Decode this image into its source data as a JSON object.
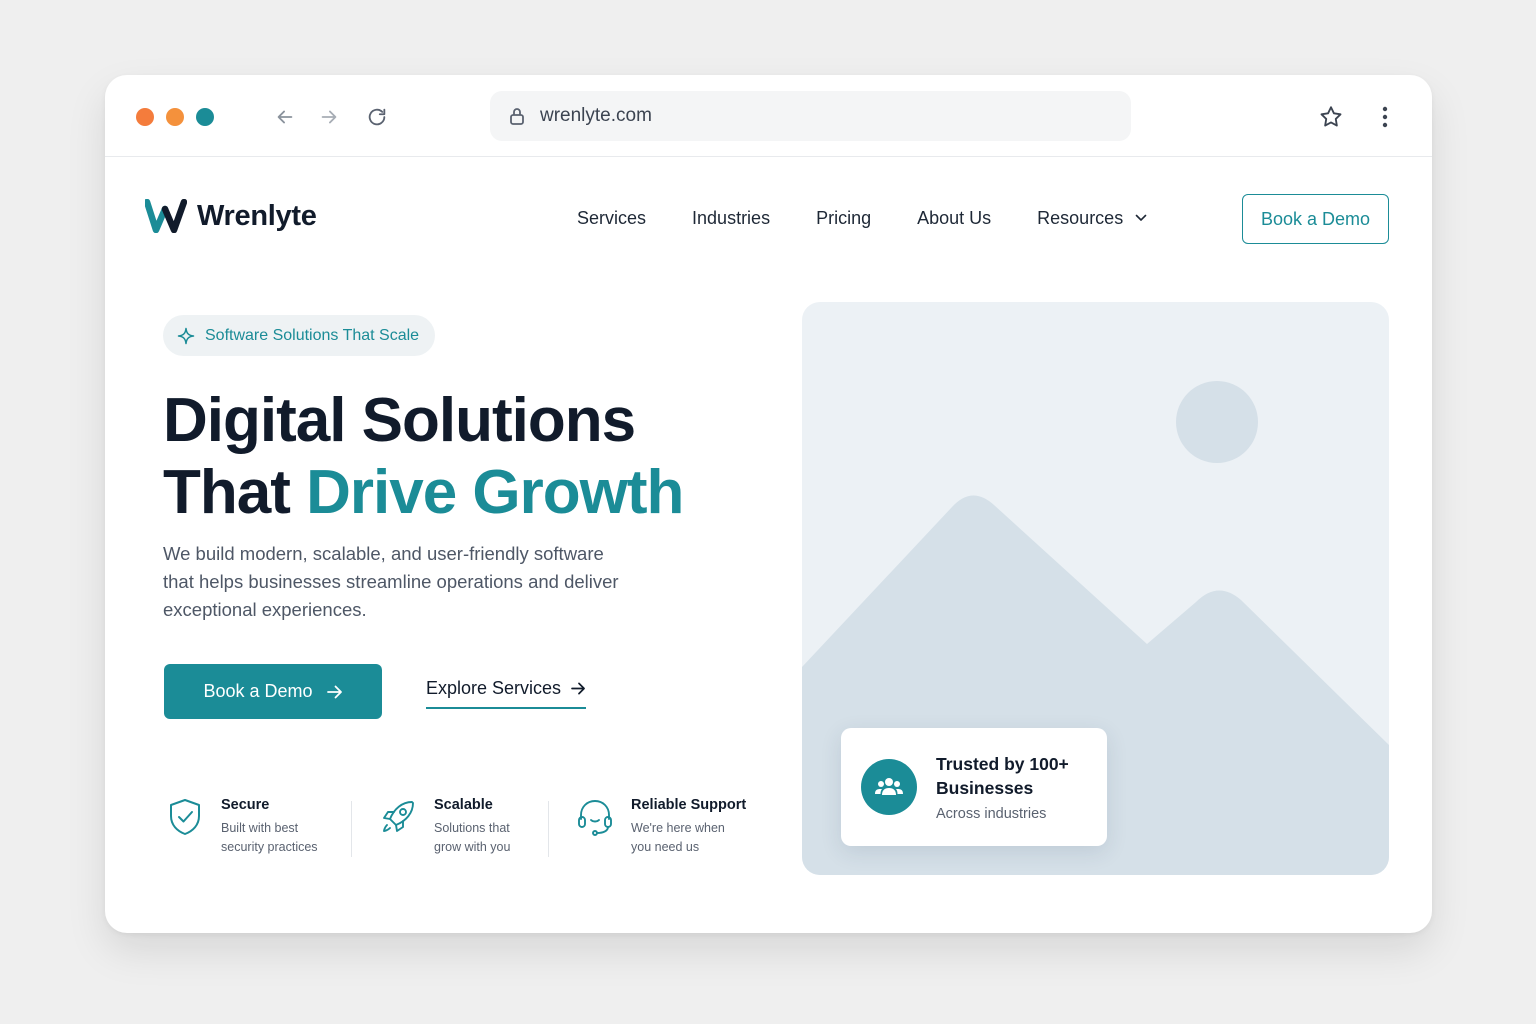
{
  "browser": {
    "url": "wrenlyte.com",
    "dots": [
      "#f47c3c",
      "#f4913c",
      "#1b8c97"
    ]
  },
  "header": {
    "brand": "Wrenlyte",
    "nav": [
      "Services",
      "Industries",
      "Pricing",
      "About Us",
      "Resources"
    ],
    "cta": "Book a Demo"
  },
  "hero": {
    "eyebrow": "Software Solutions That Scale",
    "headline_line1": "Digital Solutions",
    "headline_line2_plain": "That ",
    "headline_line2_accent": "Drive Growth",
    "subcopy": "We build modern, scalable, and user-friendly software that helps businesses streamline operations and deliver exceptional experiences.",
    "primary_cta": "Book a Demo",
    "secondary_cta": "Explore Services"
  },
  "features": [
    {
      "title": "Secure",
      "desc_line1": "Built with best",
      "desc_line2": "security practices",
      "icon": "shield-check-icon"
    },
    {
      "title": "Scalable",
      "desc_line1": "Solutions that",
      "desc_line2": "grow with you",
      "icon": "rocket-icon"
    },
    {
      "title": "Reliable Support",
      "desc_line1": "We're here when",
      "desc_line2": "you need us",
      "icon": "headset-icon"
    }
  ],
  "trust_card": {
    "title": "Trusted by 100+ Businesses",
    "subtitle": "Across industries"
  },
  "colors": {
    "accent": "#1b8c97",
    "heading": "#111b2b",
    "image_placeholder": "#ecf1f5",
    "image_shapes": "#d5e0e8"
  }
}
